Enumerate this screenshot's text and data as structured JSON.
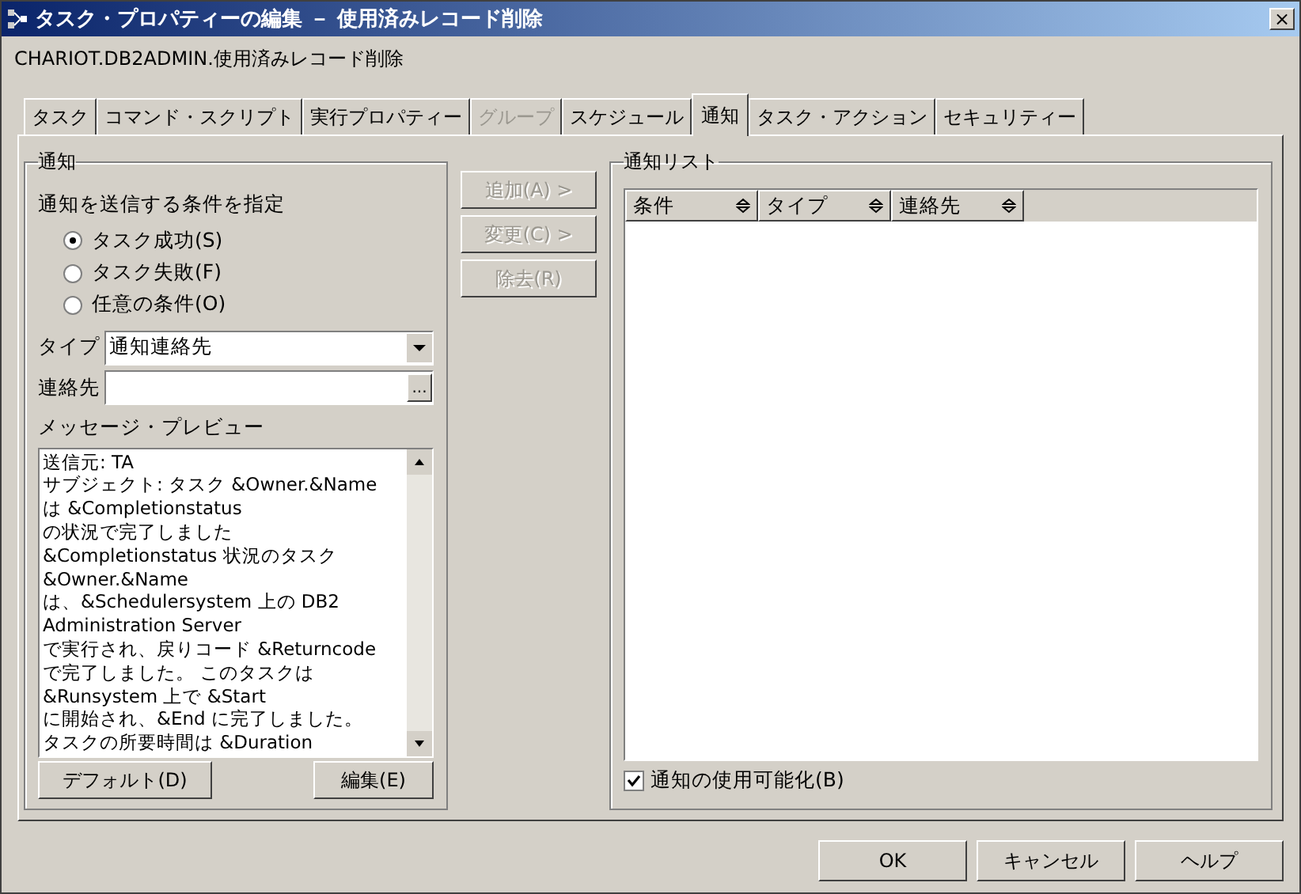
{
  "window": {
    "title": "タスク・プロパティーの編集 － 使用済みレコード削除",
    "close": "×"
  },
  "object_path": "CHARIOT.DB2ADMIN.使用済みレコード削除",
  "tabs": [
    {
      "label": "タスク",
      "selected": false,
      "disabled": false
    },
    {
      "label": "コマンド・スクリプト",
      "selected": false,
      "disabled": false
    },
    {
      "label": "実行プロパティー",
      "selected": false,
      "disabled": false
    },
    {
      "label": "グループ",
      "selected": false,
      "disabled": true
    },
    {
      "label": "スケジュール",
      "selected": false,
      "disabled": false
    },
    {
      "label": "通知",
      "selected": true,
      "disabled": false
    },
    {
      "label": "タスク・アクション",
      "selected": false,
      "disabled": false
    },
    {
      "label": "セキュリティー",
      "selected": false,
      "disabled": false
    }
  ],
  "notification": {
    "title": "通知",
    "condition_label": "通知を送信する条件を指定",
    "conditions": [
      {
        "label": "タスク成功(S)",
        "selected": true
      },
      {
        "label": "タスク失敗(F)",
        "selected": false
      },
      {
        "label": "任意の条件(O)",
        "selected": false
      }
    ],
    "type": {
      "label": "タイプ",
      "value": "通知連絡先"
    },
    "contact": {
      "label": "連絡先",
      "browse": "..."
    },
    "preview": {
      "label": "メッセージ・プレビュー",
      "lines": [
        "送信元: TA",
        "サブジェクト: タスク &Owner.&Name",
        "は &Completionstatus",
        "の状況で完了しました",
        "&Completionstatus 状況のタスク",
        "&Owner.&Name",
        "は、&Schedulersystem 上の DB2",
        "Administration Server",
        "で実行され、戻りコード &Returncode",
        "で完了しました。 このタスクは",
        "&Runsystem 上で &Start",
        "に開始され、&End に完了しました。",
        "タスクの所要時間は &Duration"
      ]
    },
    "buttons": [
      {
        "label": "デフォルト(D)"
      },
      {
        "label": "編集(E)"
      }
    ]
  },
  "action_buttons": [
    {
      "label": "追加(A) >",
      "disabled": true
    },
    {
      "label": "変更(C) >",
      "disabled": true
    },
    {
      "label": "除去(R)",
      "disabled": true
    }
  ],
  "list": {
    "title": "通知リスト",
    "columns": [
      "条件",
      "タイプ",
      "連絡先"
    ]
  },
  "enable_checkbox": {
    "label": "通知の使用可能化(B)",
    "checked": true
  },
  "footer_buttons": [
    "OK",
    "キャンセル",
    "ヘルプ"
  ]
}
